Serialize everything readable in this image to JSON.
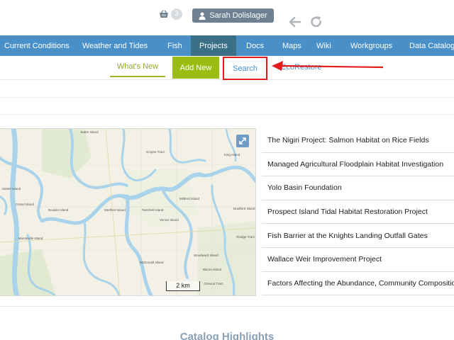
{
  "header": {
    "cart_count": "3",
    "user_name": "Sarah Dolislager",
    "icons": {
      "cart": "basket-icon",
      "user": "user-icon",
      "back": "arrow-left-icon",
      "refresh": "refresh-icon"
    }
  },
  "main_nav": {
    "items": [
      {
        "label": "Current Conditions",
        "active": false
      },
      {
        "label": "Weather and Tides",
        "active": false
      },
      {
        "label": "Fish",
        "active": false
      },
      {
        "label": "Projects",
        "active": true
      },
      {
        "label": "Docs",
        "active": false
      },
      {
        "label": "Maps",
        "active": false
      },
      {
        "label": "Wiki",
        "active": false
      },
      {
        "label": "Workgroups",
        "active": false
      },
      {
        "label": "Data Catalog",
        "active": false
      }
    ]
  },
  "sub_nav": {
    "whats_new": "What's New",
    "add_new": "Add New",
    "search": "Search",
    "ecorestore": "EcoRestore"
  },
  "map": {
    "scale_label": "2 km",
    "place_labels": [
      "Grand Island",
      "Sutter Island",
      "Empire Tract",
      "King Island",
      "Bouldin Island",
      "Medford Island",
      "Twitchell Island",
      "Venice Island",
      "Mandeville Island",
      "McDonald Island",
      "Rindge Tract",
      "Bacon Island",
      "Mildred Island",
      "Woodward Island",
      "Orwood Tract",
      "Staten Island",
      "Bradford Island"
    ]
  },
  "projects": [
    "The Nigiri Project: Salmon Habitat on Rice Fields",
    "Managed Agricultural Floodplain Habitat Investigation",
    "Yolo Basin Foundation",
    "Prospect Island Tidal Habitat Restoration Project",
    "Fish Barrier at the Knights Landing Outfall Gates",
    "Wallace Weir Improvement Project",
    "Factors Affecting the Abundance, Community Composition"
  ],
  "catalog": {
    "title": "Catalog Highlights"
  },
  "colors": {
    "nav": "#4a90c8",
    "nav_active": "#3b6f86",
    "add_new": "#9bbc12",
    "highlight": "#e41c1c"
  }
}
